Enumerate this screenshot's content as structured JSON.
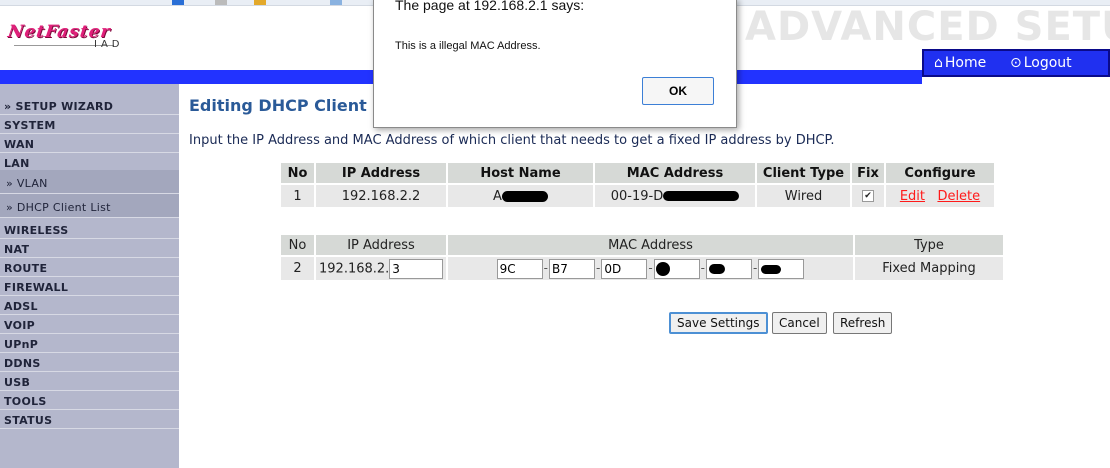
{
  "header": {
    "logo_main": "NetFaster",
    "logo_sub": "IAD",
    "title": "ADVANCED SETUP",
    "nav": {
      "home_label": "Home",
      "logout_label": "Logout"
    }
  },
  "sidebar": {
    "items": [
      {
        "label": "» SETUP WIZARD"
      },
      {
        "label": "SYSTEM"
      },
      {
        "label": "WAN"
      },
      {
        "label": "LAN"
      },
      {
        "label": "» VLAN"
      },
      {
        "label": "» DHCP Client List"
      },
      {
        "label": "WIRELESS"
      },
      {
        "label": "NAT"
      },
      {
        "label": "ROUTE"
      },
      {
        "label": "FIREWALL"
      },
      {
        "label": "ADSL"
      },
      {
        "label": "VOIP"
      },
      {
        "label": "UPnP"
      },
      {
        "label": "DDNS"
      },
      {
        "label": "USB"
      },
      {
        "label": "TOOLS"
      },
      {
        "label": "STATUS"
      }
    ]
  },
  "main": {
    "heading": "Editing DHCP Client",
    "description": "Input the IP Address and MAC Address of which client that needs to get a fixed IP address by DHCP.",
    "clients_table": {
      "headers": [
        "No",
        "IP Address",
        "Host Name",
        "MAC Address",
        "Client Type",
        "Fix",
        "Configure"
      ],
      "row": {
        "no": "1",
        "ip": "192.168.2.2",
        "host_visible": "A",
        "mac_visible": "00-19-D",
        "client_type": "Wired",
        "fix_checked": true,
        "edit_label": "Edit",
        "delete_label": "Delete"
      }
    },
    "edit_table": {
      "headers": [
        "No",
        "IP Address",
        "MAC Address",
        "Type"
      ],
      "row": {
        "no": "2",
        "ip_prefix": "192.168.2.",
        "ip_last_octet": "3",
        "mac_octets": [
          "9C",
          "B7",
          "0D",
          "",
          "",
          ""
        ],
        "type": "Fixed Mapping"
      }
    },
    "buttons": {
      "save": "Save Settings",
      "cancel": "Cancel",
      "refresh": "Refresh"
    }
  },
  "dialog": {
    "title": "The page at 192.168.2.1 says:",
    "message": "This is a illegal MAC Address.",
    "ok_label": "OK"
  },
  "colors": {
    "brand_blue": "#2233ff",
    "sidebar_bg": "#b4b7cc",
    "heading_blue": "#2a5a98",
    "link_red": "#ff1a1a",
    "logo_pink": "#e0207a"
  }
}
